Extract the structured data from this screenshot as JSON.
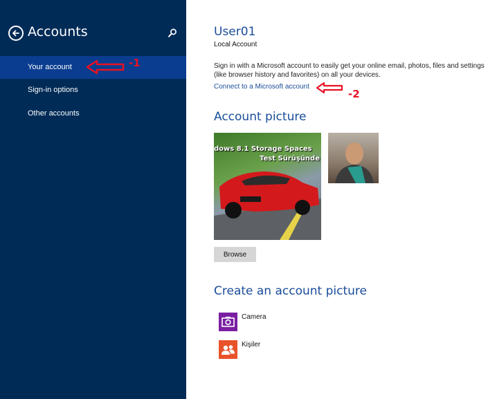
{
  "sidebar": {
    "title": "Accounts",
    "items": [
      {
        "label": "Your account",
        "active": true
      },
      {
        "label": "Sign-in options",
        "active": false
      },
      {
        "label": "Other accounts",
        "active": false
      }
    ],
    "back_icon": "back-arrow-circle-icon",
    "search_icon": "search-icon"
  },
  "main": {
    "username": "User01",
    "account_type": "Local Account",
    "description": "Sign in with a Microsoft account to easily get your online email, photos, files and settings (like browser history and favorites) on all your devices.",
    "connect_link": "Connect to a Microsoft account",
    "account_picture_heading": "Account picture",
    "picture_caption_line1": "dows 8.1 Storage Spaces",
    "picture_caption_line2": "Test Sürüşünde",
    "browse_label": "Browse",
    "create_heading": "Create an account picture",
    "create_options": [
      {
        "label": "Camera",
        "icon": "camera-icon",
        "color": "#7b1fa2"
      },
      {
        "label": "Kişiler",
        "icon": "people-icon",
        "color": "#e8532b"
      }
    ]
  },
  "annotations": [
    {
      "text": "-1"
    },
    {
      "text": "-2"
    }
  ],
  "colors": {
    "sidebar_bg": "#002b57",
    "active_item_bg": "#0a3d8f",
    "accent_text": "#1a4d9a",
    "annotation_red": "#e81123"
  }
}
